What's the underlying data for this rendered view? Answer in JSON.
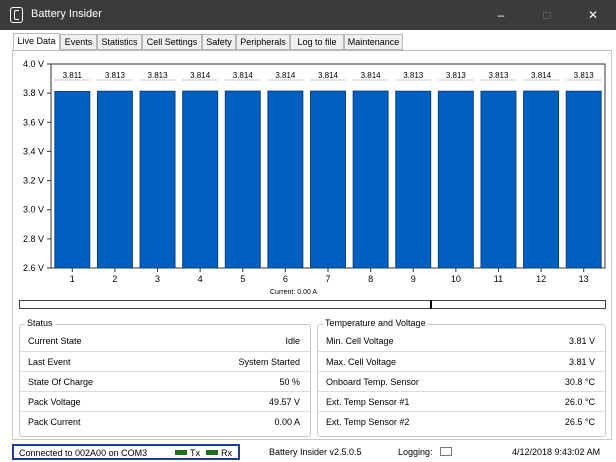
{
  "window": {
    "title": "Battery Insider",
    "minimize": "–",
    "maximize": "□",
    "close": "✕"
  },
  "tabs": [
    {
      "label": "Live Data",
      "active": true
    },
    {
      "label": "Events"
    },
    {
      "label": "Statistics"
    },
    {
      "label": "Cell Settings"
    },
    {
      "label": "Safety"
    },
    {
      "label": "Peripherals"
    },
    {
      "label": "Log to file"
    },
    {
      "label": "Maintenance"
    }
  ],
  "chart_data": {
    "type": "bar",
    "categories": [
      "1",
      "2",
      "3",
      "4",
      "5",
      "6",
      "7",
      "8",
      "9",
      "10",
      "11",
      "12",
      "13"
    ],
    "values": [
      3.811,
      3.813,
      3.813,
      3.814,
      3.814,
      3.814,
      3.814,
      3.814,
      3.813,
      3.813,
      3.813,
      3.814,
      3.813
    ],
    "value_labels": [
      "3.811",
      "3.813",
      "3.813",
      "3.814",
      "3.814",
      "3.814",
      "3.814",
      "3.814",
      "3.813",
      "3.813",
      "3.813",
      "3.814",
      "3.813"
    ],
    "ylim": [
      2.6,
      4.0
    ],
    "yticks": [
      "4.0 V",
      "3.8 V",
      "3.6 V",
      "3.4 V",
      "3.2 V",
      "3.0 V",
      "2.8 V",
      "2.6 V"
    ],
    "ytick_values": [
      4.0,
      3.8,
      3.6,
      3.4,
      3.2,
      3.0,
      2.8,
      2.6
    ],
    "bar_color": "#0060c0",
    "grid": false
  },
  "current_label": "Current: 0.00 A",
  "status": {
    "title": "Status",
    "rows": [
      {
        "label": "Current State",
        "value": "Idle"
      },
      {
        "label": "Last Event",
        "value": "System Started"
      },
      {
        "label": "State Of Charge",
        "value": "50 %"
      },
      {
        "label": "Pack Voltage",
        "value": "49.57 V"
      },
      {
        "label": "Pack Current",
        "value": "0.00 A"
      }
    ]
  },
  "temp": {
    "title": "Temperature and Voltage",
    "rows": [
      {
        "label": "Min. Cell Voltage",
        "value": "3.81 V"
      },
      {
        "label": "Max. Cell Voltage",
        "value": "3.81 V"
      },
      {
        "label": "Onboard Temp. Sensor",
        "value": "30.8 °C"
      },
      {
        "label": "Ext. Temp Sensor #1",
        "value": "26.0 °C"
      },
      {
        "label": "Ext. Temp Sensor #2",
        "value": "26.5 °C"
      }
    ]
  },
  "statusbar": {
    "connection": "Connected to 002A00 on COM3",
    "tx": "Tx",
    "rx": "Rx",
    "version": "Battery Insider v2.5.0.5",
    "logging": "Logging:",
    "datetime": "4/12/2018 9:43:02 AM"
  }
}
